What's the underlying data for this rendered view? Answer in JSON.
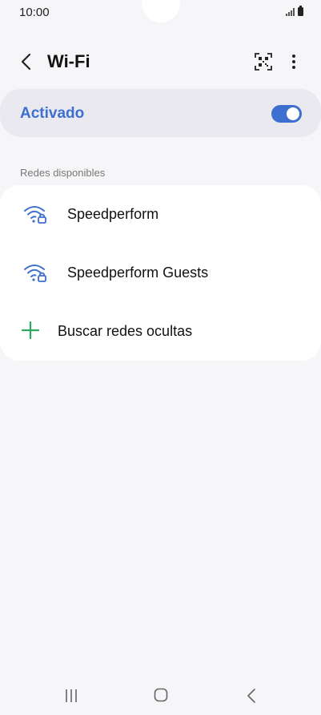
{
  "status_bar": {
    "time": "10:00"
  },
  "header": {
    "title": "Wi-Fi",
    "back_icon": "chevron-left-icon",
    "qr_icon": "qr-code-scanner-icon",
    "more_icon": "more-vertical-icon"
  },
  "master": {
    "label": "Activado",
    "enabled": true
  },
  "networks_section": {
    "title": "Redes disponibles",
    "items": [
      {
        "name": "Speedperform",
        "icon": "wifi-secured-icon"
      },
      {
        "name": "Speedperform Guests",
        "icon": "wifi-secured-icon"
      }
    ],
    "add_hidden_label": "Buscar redes ocultas"
  },
  "colors": {
    "accent": "#3d6fd0",
    "add_icon": "#2daa5f",
    "background": "#f6f6f9",
    "card": "#ffffff",
    "master_card": "#e9e9ef"
  }
}
